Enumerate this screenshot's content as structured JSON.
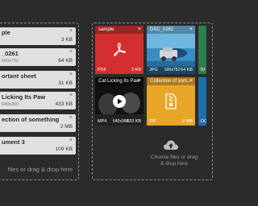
{
  "left_list": {
    "files": [
      {
        "name": "ple",
        "dimensions": "",
        "size": "3 KB"
      },
      {
        "name": "_0261",
        "dimensions": "500x752",
        "size": "64 KB"
      },
      {
        "name": "ortant sheet",
        "dimensions": "",
        "size": "31 KB"
      },
      {
        "name": "Licking Its Paw",
        "dimensions": "640x360",
        "size": "433 KB"
      },
      {
        "name": "ection of something",
        "dimensions": "",
        "size": "2 MB"
      },
      {
        "name": "ument 3",
        "dimensions": "",
        "size": "109 KB"
      }
    ],
    "close_glyph": "×",
    "drop_text": "files or drag & drop here"
  },
  "right_grid": {
    "tiles": [
      {
        "title": "sample",
        "type": "PDF",
        "dimensions": "",
        "size": "3 KB",
        "color": "#d32f2f",
        "icon": "pdf-icon"
      },
      {
        "title": "DSC_0261",
        "type": "JPG",
        "dimensions": "500x752",
        "size": "64 KB",
        "color": "#1e6fa8",
        "icon": "photo-thumbnail"
      },
      {
        "title": "Cat Licking Its Paw",
        "type": "MP4",
        "dimensions": "640x360",
        "size": "433 KB",
        "color": "#1a1a1a",
        "icon": "play-icon"
      },
      {
        "title": "Collection of som...",
        "type": "ZIP",
        "dimensions": "",
        "size": "2 MB",
        "color": "#e8a628",
        "icon": "zip-icon"
      }
    ],
    "partial_labels": [
      "BI",
      "DO"
    ],
    "close_glyph": "×",
    "drop_text_line1": "Choose files or drag",
    "drop_text_line2": "& drop here"
  }
}
